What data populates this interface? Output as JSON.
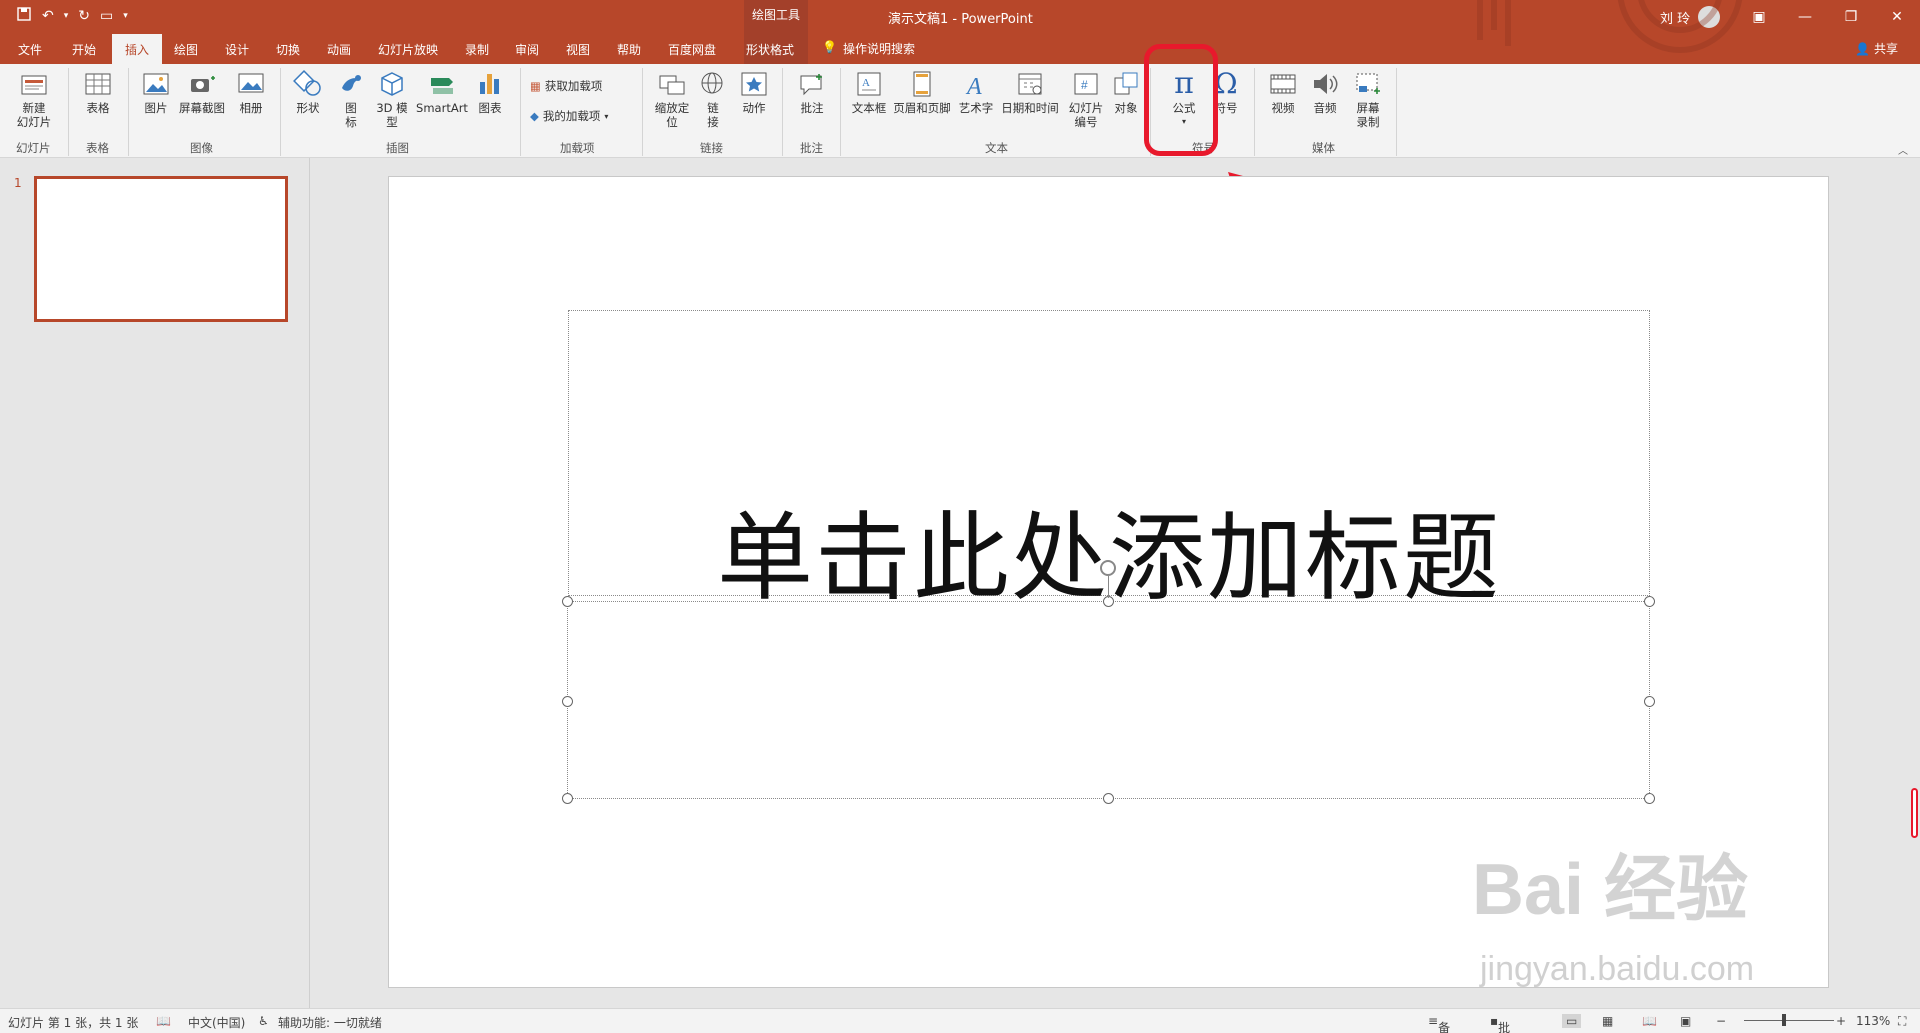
{
  "titlebar": {
    "context_tool": "绘图工具",
    "doc_title": "演示文稿1  -  PowerPoint",
    "user_name": "刘 玲",
    "qat_icons": [
      "save-icon",
      "undo-icon",
      "redo-icon",
      "presentation-icon"
    ],
    "win_controls": [
      "ribbon-display-icon",
      "minimize-icon",
      "restore-icon",
      "close-icon"
    ]
  },
  "tabs": {
    "items": [
      "文件",
      "开始",
      "插入",
      "绘图",
      "设计",
      "切换",
      "动画",
      "幻灯片放映",
      "录制",
      "审阅",
      "视图",
      "帮助",
      "百度网盘",
      "形状格式"
    ],
    "active": "插入",
    "search_label": "操作说明搜索",
    "share_label": "共享"
  },
  "ribbon": {
    "groups": {
      "slides": "幻灯片",
      "tables": "表格",
      "images": "图像",
      "illustrations": "插图",
      "addins": "加载项",
      "links": "链接",
      "comments": "批注",
      "text": "文本",
      "symbols": "符号",
      "media": "媒体"
    },
    "buttons": {
      "new_slide": "新建\n幻灯片",
      "table": "表格",
      "picture": "图片",
      "screenshot": "屏幕截图",
      "album": "相册",
      "shapes": "形状",
      "icons": "图\n标",
      "model3d": "3D 模\n型",
      "smartart": "SmartArt",
      "chart": "图表",
      "get_addins": "获取加载项",
      "my_addins": "我的加载项",
      "zoom": "缩放定\n位",
      "link": "链\n接",
      "action": "动作",
      "comment": "批注",
      "textbox": "文本框",
      "header_footer": "页眉和页脚",
      "wordart": "艺术字",
      "datetime": "日期和时间",
      "slide_number": "幻灯片\n编号",
      "object": "对象",
      "equation": "公式",
      "symbol": "符号",
      "video": "视频",
      "audio": "音频",
      "screen_record": "屏幕\n录制"
    }
  },
  "slide_panel": {
    "slide_number": "1"
  },
  "slide": {
    "title_placeholder": "单击此处添加标题"
  },
  "watermark": {
    "line1": "Bai 经验",
    "line2": "jingyan.baidu.com"
  },
  "status": {
    "slide_info": "幻灯片 第 1 张，共 1 张",
    "language": "中文(中国)",
    "accessibility": "辅助功能: 一切就绪",
    "notes": "备注",
    "comments": "批注",
    "zoom": "113%"
  },
  "colors": {
    "accent": "#b7472a",
    "highlight": "#e8192c"
  }
}
